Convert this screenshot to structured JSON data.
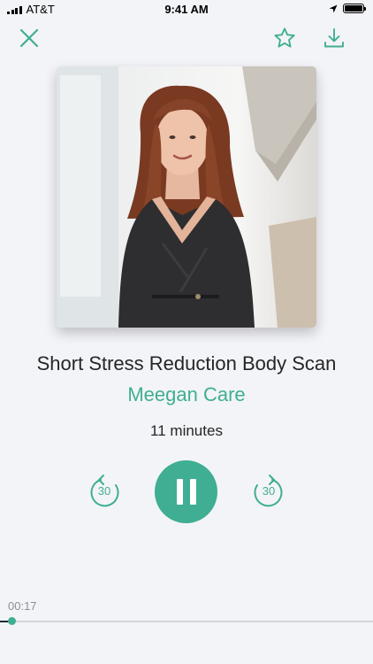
{
  "status_bar": {
    "carrier": "AT&T",
    "time": "9:41 AM"
  },
  "toolbar": {
    "close_icon": "close-icon",
    "favorite_icon": "star-outline-icon",
    "download_icon": "download-icon"
  },
  "track": {
    "title": "Short Stress Reduction Body Scan",
    "artist": "Meegan Care",
    "duration": "11 minutes"
  },
  "controls": {
    "skip_back_label": "30",
    "skip_forward_label": "30"
  },
  "progress": {
    "elapsed": "00:17",
    "fraction": 0.03
  },
  "colors": {
    "accent": "#3fae92",
    "background": "#f3f4f8",
    "text": "#262626"
  }
}
